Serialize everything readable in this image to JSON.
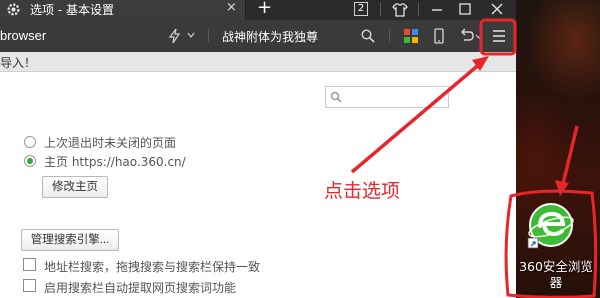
{
  "window": {
    "tab_title": "选项 - 基本设置",
    "tab_close_glyph": "×",
    "new_tab_glyph": "+",
    "window_count": "2",
    "minimize_glyph": "—",
    "maximize_glyph": "□",
    "close_glyph": "×"
  },
  "toolbar": {
    "product_name": "browser",
    "search_text": "战神附体为我独尊"
  },
  "notification": {
    "text": "导入！"
  },
  "settings": {
    "search_placeholder": "",
    "startup_options": [
      {
        "label": "上次退出时未关闭的页面",
        "checked": false
      },
      {
        "label": "主页  https://hao.360.cn/",
        "checked": true
      }
    ],
    "edit_home_button": "修改主页",
    "manage_search_button": "管理搜索引擎...",
    "checkboxes": [
      {
        "label": "地址栏搜索，拖拽搜索与搜索栏保持一致",
        "checked": false
      },
      {
        "label": "启用搜索栏自动提取网页搜索词功能",
        "checked": false
      }
    ]
  },
  "desktop": {
    "app_label": "360安全浏览器"
  },
  "annotation": {
    "text": "点击选项",
    "color": "#e8262a"
  },
  "colors": {
    "titlebar": "#2b2b2b",
    "toolbar": "#3a3a3a",
    "radio_checked": "#2eaa38",
    "annotation_red": "#e8262a",
    "app_icon_green": "#3dbb37"
  }
}
